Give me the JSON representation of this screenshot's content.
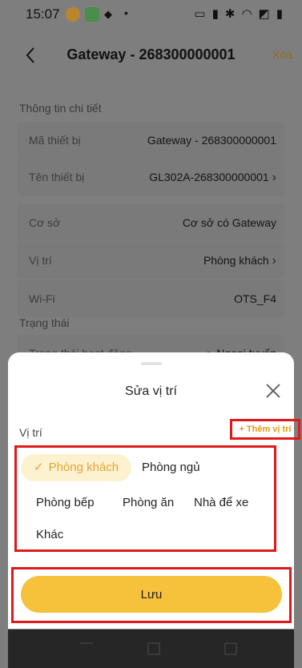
{
  "status_bar": {
    "time": "15:07",
    "dot": "•",
    "icons": [
      "cast-icon",
      "vibrate-icon",
      "bluetooth-icon",
      "wifi-icon",
      "signal-icon",
      "battery-icon"
    ]
  },
  "header": {
    "title": "Gateway - 268300000001",
    "delete_label": "Xoá"
  },
  "details": {
    "section_title": "Thông tin chi tiết",
    "rows": [
      {
        "label": "Mã thiết bị",
        "value": "Gateway - 268300000001"
      },
      {
        "label": "Tên thiết bị",
        "value": "GL302A-268300000001"
      },
      {
        "label": "Cơ sở",
        "value": "Cơ sở có Gateway"
      },
      {
        "label": "Vị trí",
        "value": "Phòng khách"
      },
      {
        "label": "Wi-Fi",
        "value": "OTS_F4"
      }
    ]
  },
  "status_section": {
    "title": "Trạng thái",
    "row_label": "Trạng thái hoạt động",
    "row_value": "Ngoại tuyến"
  },
  "sheet": {
    "title": "Sửa vị trí",
    "location_label": "Vị trí",
    "add_location": "+ Thêm vị trí",
    "chips": [
      {
        "label": "Phòng khách",
        "selected": true
      },
      {
        "label": "Phòng ngủ"
      },
      {
        "label": "Phòng bếp"
      },
      {
        "label": "Phòng ăn"
      },
      {
        "label": "Nhà để xe"
      },
      {
        "label": "Khác"
      }
    ],
    "save_label": "Lưu"
  },
  "colors": {
    "accent": "#f6c13b",
    "highlight_border": "#e0191b",
    "chip_selected_bg": "#fdf2cf"
  }
}
